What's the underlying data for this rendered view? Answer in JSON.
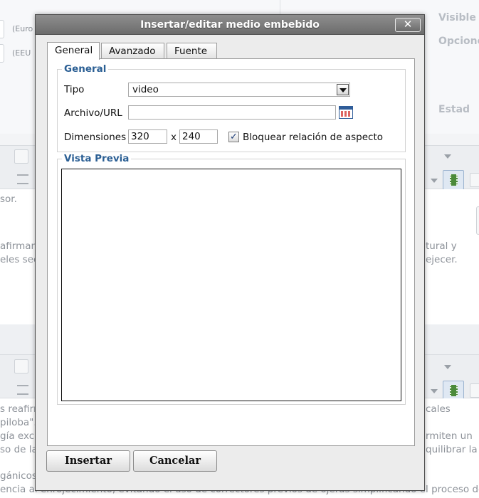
{
  "background": {
    "currency_1": "(Euro",
    "currency_2": "(EEU",
    "right_label_1": "Visible e",
    "right_label_2": "Opcione",
    "right_label_3": "Estad",
    "editor1_lines": [
      "sor.",
      "afirman",
      "eles sec"
    ],
    "editor1_right_lines": [
      "tural y",
      "ejecer."
    ],
    "editor2_lines": [
      "s reafirm",
      "piloba\".",
      "gía exc",
      "so de la",
      "gánicos"
    ],
    "editor2_right_lines": [
      "cales",
      "rmiten un",
      "quilibrar la"
    ],
    "bottom_line": "encia al enrojecimiento, evitando el uso de correctores previos de ojeras simplificando el proceso de"
  },
  "dialog": {
    "title": "Insertar/editar medio embebido",
    "close_label": "✕",
    "tabs": [
      {
        "label": "General"
      },
      {
        "label": "Avanzado"
      },
      {
        "label": "Fuente"
      }
    ],
    "general_section": {
      "legend": "General",
      "tipo_label": "Tipo",
      "tipo_value": "video",
      "archivo_label": "Archivo/URL",
      "archivo_value": "",
      "dimensiones_label": "Dimensiones",
      "width_value": "320",
      "height_value": "240",
      "by_label": "x",
      "lock_label": "Bloquear relación de aspecto",
      "lock_checked": true,
      "check_glyph": "✓"
    },
    "preview_section": {
      "legend": "Vista Previa"
    },
    "insert_label": "Insertar",
    "cancel_label": "Cancelar"
  }
}
